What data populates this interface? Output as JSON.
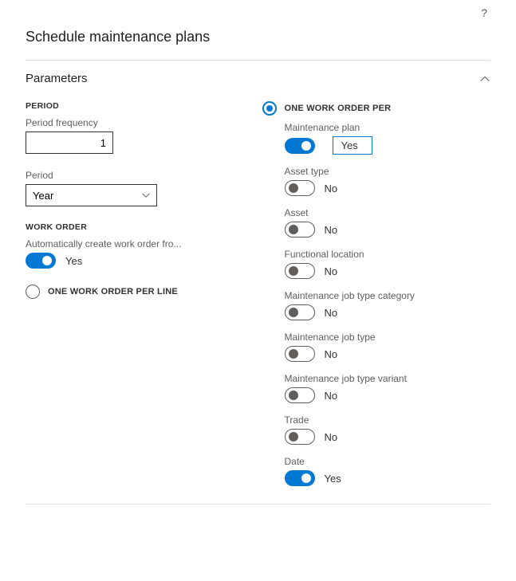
{
  "page_title": "Schedule maintenance plans",
  "section_title": "Parameters",
  "left": {
    "period_group": "PERIOD",
    "period_frequency_label": "Period frequency",
    "period_frequency_value": "1",
    "period_label": "Period",
    "period_value": "Year",
    "work_order_group": "WORK ORDER",
    "auto_create_label": "Automatically create work order fro...",
    "auto_create_value": "Yes",
    "radio_per_line": "ONE WORK ORDER PER LINE"
  },
  "right": {
    "radio_per": "ONE WORK ORDER PER",
    "fields": [
      {
        "label": "Maintenance plan",
        "value": "Yes",
        "on": true,
        "boxed": true
      },
      {
        "label": "Asset type",
        "value": "No",
        "on": false
      },
      {
        "label": "Asset",
        "value": "No",
        "on": false
      },
      {
        "label": "Functional location",
        "value": "No",
        "on": false
      },
      {
        "label": "Maintenance job type category",
        "value": "No",
        "on": false
      },
      {
        "label": "Maintenance job type",
        "value": "No",
        "on": false
      },
      {
        "label": "Maintenance job type variant",
        "value": "No",
        "on": false
      },
      {
        "label": "Trade",
        "value": "No",
        "on": false
      },
      {
        "label": "Date",
        "value": "Yes",
        "on": true
      }
    ]
  }
}
